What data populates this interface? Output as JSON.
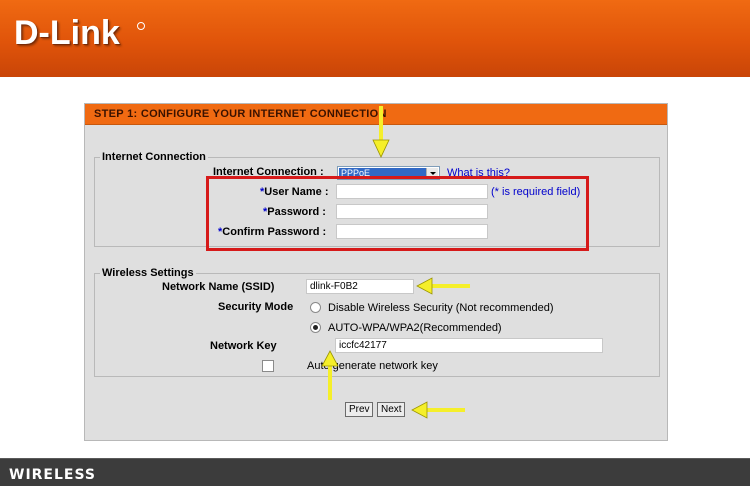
{
  "header": {
    "brand": "D-Link"
  },
  "step": {
    "title": "STEP 1: CONFIGURE YOUR INTERNET CONNECTION"
  },
  "internet": {
    "legend": "Internet Connection",
    "conn_label": "Internet Connection :",
    "conn_value": "PPPoE",
    "help_link": "What is this?",
    "req_mark": "*",
    "user_label": "User Name :",
    "pass_label": "Password :",
    "confirm_label": "Confirm Password :",
    "required_note": "(* is required field)"
  },
  "wireless": {
    "legend": "Wireless Settings",
    "ssid_label": "Network Name (SSID)",
    "ssid_value": "dlink-F0B2",
    "security_label": "Security Mode",
    "option_disable": "Disable Wireless Security (Not recommended)",
    "option_auto": "AUTO-WPA/WPA2(Recommended)",
    "selected": "auto",
    "key_label": "Network Key",
    "key_value": "iccfc42177",
    "autogen_label": "Auto generate network key"
  },
  "buttons": {
    "prev": "Prev",
    "next": "Next"
  },
  "footer": {
    "label": "WIRELESS"
  },
  "colors": {
    "brand_orange": "#f06a12",
    "highlight_red": "#d61a1a",
    "arrow_yellow": "#f5ef2a",
    "footer": "#3c3c3c",
    "panel": "#dfdfdf"
  },
  "icons": {
    "arrow": "arrow-pointer-icon",
    "dropdown": "chevron-down-icon"
  }
}
